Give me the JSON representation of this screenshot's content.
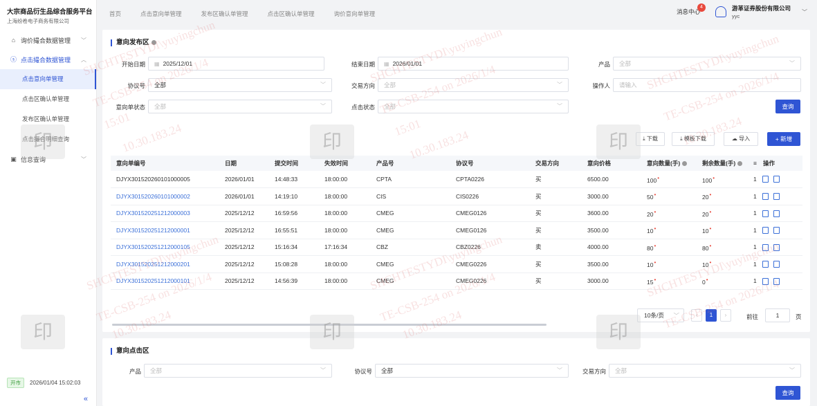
{
  "brand": {
    "title": "大宗商品衍生品综合服务平台",
    "subtitle": "上海纷卷电子商务有限公司"
  },
  "sidebar": {
    "menu1": "询价撮合数据管理",
    "menu2": "点击撮合数据管理",
    "sub": [
      "点击意向单管理",
      "点击区确认单管理",
      "发布区确认单管理",
      "点击撮合明细查询"
    ],
    "menu3": "信息查询",
    "status": "开市",
    "datetime": "2026/01/04 15:02:03",
    "collapse": "«"
  },
  "topnav": [
    "首页",
    "点击意向单管理",
    "发布区确认单管理",
    "点击区确认单管理",
    "询价意向单管理"
  ],
  "header": {
    "msg_center": "消息中心",
    "msg_count": "4",
    "company": "游革证券股份有限公司",
    "user": "yyc"
  },
  "publish": {
    "title": "意向发布区",
    "labels": {
      "start": "开始日期",
      "end": "结束日期",
      "product": "产品",
      "agreement": "协议号",
      "direction": "交易方向",
      "operator": "操作人",
      "status": "意向单状态",
      "click_status": "点击状态"
    },
    "values": {
      "start": "2025/12/01",
      "end": "2026/01/01",
      "product": "全部",
      "agreement": "全部",
      "direction": "全部",
      "operator": "请输入",
      "status": "全部",
      "click_status": "全部"
    },
    "buttons": {
      "query": "查询",
      "download": "下载",
      "template": "模板下载",
      "import": "导入",
      "add": "+ 新增"
    }
  },
  "table": {
    "headers": [
      "意向单编号",
      "日期",
      "提交时间",
      "失效时间",
      "产品号",
      "协议号",
      "交易方向",
      "意向价格",
      "意向数量(手)",
      "剩余数量(手)",
      "≡",
      "操作"
    ],
    "rows": [
      [
        "DJYX301520260101000005",
        "2026/01/01",
        "14:48:33",
        "18:00:00",
        "CPTA",
        "CPTA0226",
        "买",
        "6500.00",
        "100",
        "100",
        "1"
      ],
      [
        "DJYX301520260101000002",
        "2026/01/01",
        "14:19:10",
        "18:00:00",
        "CIS",
        "CIS0226",
        "买",
        "3000.00",
        "50",
        "20",
        "1"
      ],
      [
        "DJYX301520251212000003",
        "2025/12/12",
        "16:59:56",
        "18:00:00",
        "CMEG",
        "CMEG0126",
        "买",
        "3600.00",
        "20",
        "20",
        "1"
      ],
      [
        "DJYX301520251212000001",
        "2025/12/12",
        "16:55:51",
        "18:00:00",
        "CMEG",
        "CMEG0126",
        "买",
        "3500.00",
        "10",
        "10",
        "1"
      ],
      [
        "DJYX301520251212000105",
        "2025/12/12",
        "15:16:34",
        "17:16:34",
        "CBZ",
        "CBZ0226",
        "卖",
        "4000.00",
        "80",
        "80",
        "1"
      ],
      [
        "DJYX301520251212000201",
        "2025/12/12",
        "15:08:28",
        "18:00:00",
        "CMEG",
        "CMEG0226",
        "买",
        "3500.00",
        "10",
        "10",
        "1"
      ],
      [
        "DJYX301520251212000101",
        "2025/12/12",
        "14:56:39",
        "18:00:00",
        "CMEG",
        "CMEG0226",
        "买",
        "3000.00",
        "15",
        "0",
        "1"
      ]
    ]
  },
  "pagination": {
    "size": "10条/页",
    "current": "1",
    "goto": "前往",
    "page_value": "1",
    "page_unit": "页",
    "prev": "‹",
    "next": "›"
  },
  "click_area": {
    "title": "意向点击区",
    "labels": {
      "product": "产品",
      "agreement": "协议号",
      "direction": "交易方向"
    },
    "values": {
      "product": "全部",
      "agreement": "全部",
      "direction": "全部"
    },
    "query": "查询"
  },
  "watermark": {
    "line1": "SHCHTESTYDI\\yuyingchun",
    "line2": "TE-CSB-254 on 2026/1/4",
    "line3": "15:01",
    "line4": "10.30.183.24",
    "stamp": "印"
  },
  "colors": {
    "primary": "#2f55d4",
    "link": "#3a6fd8",
    "badge": "#e8493d"
  }
}
